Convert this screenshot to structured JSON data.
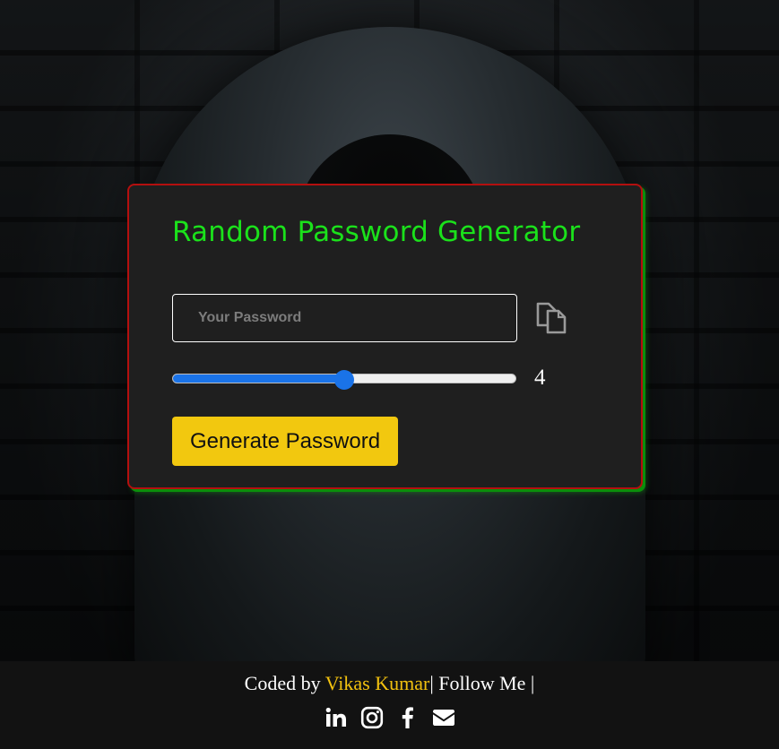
{
  "card": {
    "title": "Random Password Generator",
    "password_placeholder": "Your Password",
    "password_value": "",
    "copy_icon": "copy-icon",
    "length_value": "4",
    "slider_fraction": 0.5,
    "generate_label": "Generate Password"
  },
  "footer": {
    "prefix": "Coded by ",
    "author": "Vikas Kumar",
    "suffix": "| Follow Me |",
    "social_icons": [
      "linkedin-icon",
      "instagram-icon",
      "facebook-icon",
      "email-icon"
    ]
  },
  "colors": {
    "title": "#1be11b",
    "button": "#f2c80f",
    "slider": "#1a73e8",
    "author": "#f2c10f",
    "card_border": "#b40f0f",
    "card_shadow": "#0b8f0b"
  }
}
